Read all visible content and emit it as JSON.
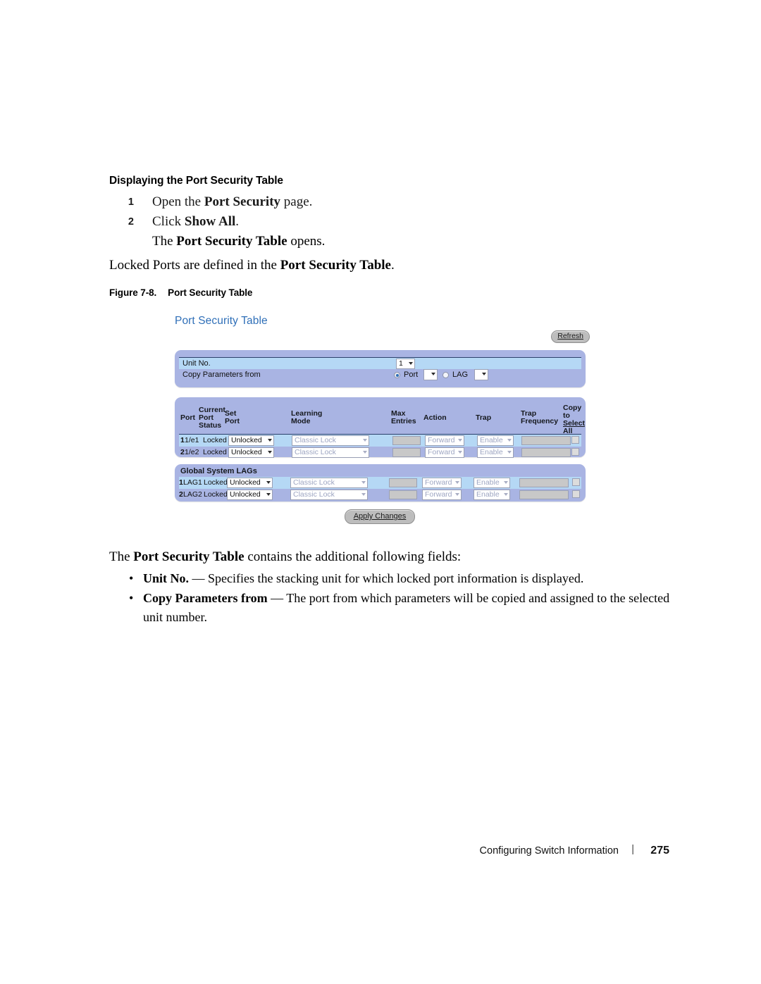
{
  "doc": {
    "heading": "Displaying the Port Security Table",
    "steps": [
      {
        "num": "1",
        "pre": "Open the ",
        "bold": "Port Security",
        "post": " page."
      },
      {
        "num": "2",
        "pre": "Click ",
        "bold": "Show All",
        "post": "."
      }
    ],
    "step_continuation": {
      "pre": "The ",
      "bold": "Port Security Table",
      "post": " opens."
    },
    "locked_paragraph": {
      "pre": "Locked Ports are defined in the ",
      "bold": "Port Security Table",
      "post": "."
    },
    "figure_caption": {
      "number": "Figure 7-8.",
      "title": "Port Security Table"
    },
    "after_paragraph": {
      "pre": "The ",
      "bold": "Port Security Table",
      "post": " contains the additional following fields:"
    },
    "bullets": [
      {
        "marker": "•",
        "term": "Unit No.",
        "text": " — Specifies the stacking unit for which locked port information is displayed."
      },
      {
        "marker": "•",
        "term": "Copy Parameters from",
        "text": " — The port from which parameters will be copied and assigned to the selected unit number."
      }
    ],
    "footer": {
      "chapter": "Configuring Switch Information",
      "separator": "|",
      "page": "275"
    }
  },
  "screenshot": {
    "title": "Port Security Table",
    "refresh_button": "Refresh",
    "apply_button": "Apply Changes",
    "unit_panel": {
      "unit_label": "Unit No.",
      "unit_value": "1",
      "copy_label": "Copy Parameters from",
      "port_radio_label": "Port",
      "port_select_value": "",
      "lag_radio_label": "LAG",
      "lag_select_value": "",
      "port_radio_selected": "true",
      "lag_radio_selected": "false"
    },
    "table": {
      "headers": {
        "port": "Port",
        "current_port_status": "Current\nPort\nStatus",
        "current_l1": "Current",
        "current_l2": "Port",
        "current_l3": "Status",
        "set_port_l1": "Set",
        "set_port_l2": "Port",
        "learning_mode_l1": "Learning",
        "learning_mode_l2": "Mode",
        "max_entries_l1": "Max",
        "max_entries_l2": "Entries",
        "action": "Action",
        "trap": "Trap",
        "trap_frequency_l1": "Trap",
        "trap_frequency_l2": "Frequency",
        "copy_to_l1": "Copy",
        "copy_to_l2": "to",
        "select_all_l1": "Select",
        "select_all_l2": "All"
      },
      "rows": [
        {
          "index": "1",
          "port": "1/e1",
          "current_status": "Locked",
          "set_port": "Unlocked",
          "learning_mode": "Classic Lock",
          "max_entries": "",
          "action": "Forward",
          "trap": "Enable",
          "trap_frequency": "",
          "copy_to": "false"
        },
        {
          "index": "2",
          "port": "1/e2",
          "current_status": "Locked",
          "set_port": "Unlocked",
          "learning_mode": "Classic Lock",
          "max_entries": "",
          "action": "Forward",
          "trap": "Enable",
          "trap_frequency": "",
          "copy_to": "false"
        }
      ]
    },
    "lags": {
      "title": "Global System LAGs",
      "rows": [
        {
          "index": "1",
          "port": "LAG1",
          "current_status": "Locked",
          "set_port": "Unlocked",
          "learning_mode": "Classic Lock",
          "max_entries": "",
          "action": "Forward",
          "trap": "Enable",
          "trap_frequency": "",
          "copy_to": "false"
        },
        {
          "index": "2",
          "port": "LAG2",
          "current_status": "Locked",
          "set_port": "Unlocked",
          "learning_mode": "Classic Lock",
          "max_entries": "",
          "action": "Forward",
          "trap": "Enable",
          "trap_frequency": "",
          "copy_to": "false"
        }
      ]
    },
    "colors": {
      "panel_blue": "#a9b4e3",
      "row_highlight": "#b5d8f5",
      "title_blue": "#2f6fb8",
      "button_grey": "#bdbdbd",
      "disabled_text": "#9ea6c2",
      "disabled_field": "#c8c8c8",
      "rule_navy": "#2b3f6b"
    }
  }
}
